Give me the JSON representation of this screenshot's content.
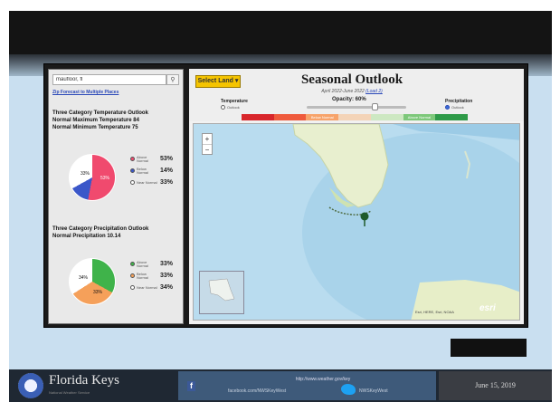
{
  "left_panel": {
    "search_value": "maufloor, fl",
    "zoom_link": "Zip Forecast to Multiple Places",
    "temperature": {
      "title": "Three Category Temperature Outlook",
      "normal_max": "Normal Maximum Temperature  84",
      "normal_min": "Normal Minimum Temperature  75",
      "pie": {
        "above": 53,
        "near": 33,
        "below": 14
      },
      "legend": [
        {
          "label": "Above Normal",
          "pct": "53%",
          "color": "#f04a6e"
        },
        {
          "label": "Below Normal",
          "pct": "14%",
          "color": "#3b57c9"
        },
        {
          "label": "Near Normal",
          "pct": "33%",
          "color": "#ffffff"
        }
      ],
      "slice_labels": {
        "near": "33%",
        "above": "53%"
      }
    },
    "precipitation": {
      "title": "Three Category Precipitation Outlook",
      "normal": "Normal Precipitation  10.14",
      "pie": {
        "above": 33,
        "below": 33,
        "near": 34
      },
      "legend": [
        {
          "label": "Above Normal",
          "pct": "33%",
          "color": "#3fb34a"
        },
        {
          "label": "Below Normal",
          "pct": "33%",
          "color": "#f5a05a"
        },
        {
          "label": "Near Normal",
          "pct": "34%",
          "color": "#ffffff"
        }
      ],
      "slice_labels": {
        "near": "34%",
        "below": "33%"
      }
    }
  },
  "header": {
    "select_land": "Select Land ▾",
    "title": "Seasonal Outlook",
    "date_prefix": "April 2022-June 2022",
    "date_link": "(Load 2)",
    "temperature_label": "Temperature",
    "temperature_radio": "Outlook",
    "opacity_label": "Opacity: 60%",
    "precipitation_label": "Precipitation",
    "precipitation_radio": "Outlook",
    "color_bar": [
      {
        "label": "",
        "color": "#d8262b"
      },
      {
        "label": "",
        "color": "#ef5a3c"
      },
      {
        "label": "Below Normal",
        "color": "#f7a36a"
      },
      {
        "label": "",
        "color": "#f4d4b8"
      },
      {
        "label": "",
        "color": "#cde8c2"
      },
      {
        "label": "Above Normal",
        "color": "#7dc87a"
      },
      {
        "label": "",
        "color": "#2e9a48"
      }
    ]
  },
  "map": {
    "zoom_in": "+",
    "zoom_out": "−",
    "attribution": "Esri, HERE, Esri, NOAA",
    "logo": "esri"
  },
  "footer": {
    "title": "Florida Keys",
    "subtitle": "National Weather Service",
    "web_url": "http://www.weather.gov/key",
    "facebook_url": "facebook.com/NWSKeyWest",
    "twitter_url": "NWSKeyWest",
    "date": "June 15, 2019"
  }
}
